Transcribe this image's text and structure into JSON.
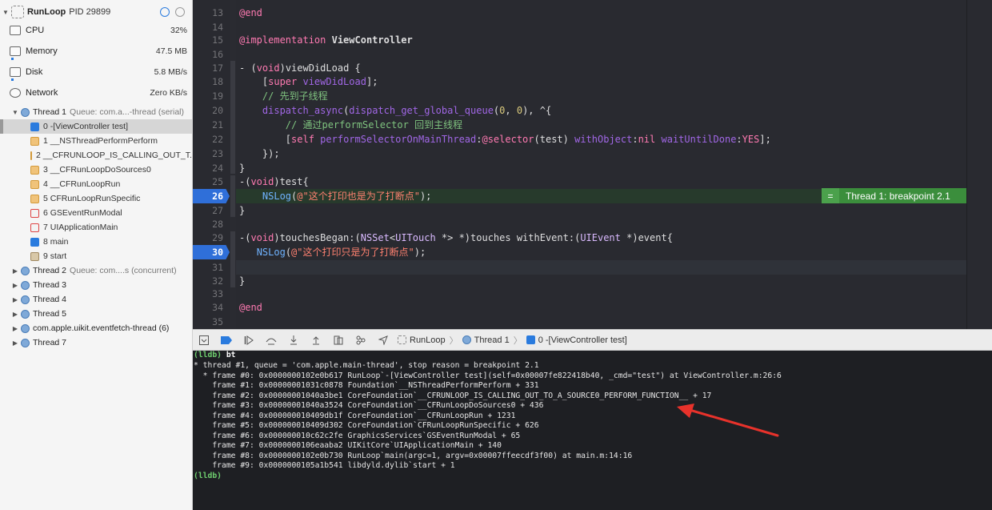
{
  "process": {
    "name": "RunLoop",
    "pid_label": "PID 29899"
  },
  "gauges": [
    {
      "label": "CPU",
      "value": "32%",
      "icon": "cpu-icon"
    },
    {
      "label": "Memory",
      "value": "47.5 MB",
      "icon": "memory-icon"
    },
    {
      "label": "Disk",
      "value": "5.8 MB/s",
      "icon": "disk-icon"
    },
    {
      "label": "Network",
      "value": "Zero KB/s",
      "icon": "network-icon"
    }
  ],
  "thread1": {
    "label": "Thread 1",
    "queue": "Queue: com.a...-thread (serial)"
  },
  "frames": [
    {
      "label": "0 -[ViewController test]",
      "kind": "user"
    },
    {
      "label": "1 __NSThreadPerformPerform",
      "kind": "sys"
    },
    {
      "label": "2 __CFRUNLOOP_IS_CALLING_OUT_T...",
      "kind": "sys"
    },
    {
      "label": "3 __CFRunLoopDoSources0",
      "kind": "sys"
    },
    {
      "label": "4 __CFRunLoopRun",
      "kind": "sys"
    },
    {
      "label": "5 CFRunLoopRunSpecific",
      "kind": "sys"
    },
    {
      "label": "6 GSEventRunModal",
      "kind": "red"
    },
    {
      "label": "7 UIApplicationMain",
      "kind": "red"
    },
    {
      "label": "8 main",
      "kind": "user"
    },
    {
      "label": "9 start",
      "kind": "grey"
    }
  ],
  "other_threads": [
    {
      "label": "Thread 2",
      "queue": "Queue: com....s (concurrent)"
    },
    {
      "label": "Thread 3",
      "queue": ""
    },
    {
      "label": "Thread 4",
      "queue": ""
    },
    {
      "label": "Thread 5",
      "queue": ""
    },
    {
      "label": "com.apple.uikit.eventfetch-thread (6)",
      "queue": ""
    },
    {
      "label": "Thread 7",
      "queue": ""
    }
  ],
  "editor": {
    "line_numbers": [
      "13",
      "14",
      "15",
      "16",
      "17",
      "18",
      "19",
      "20",
      "21",
      "22",
      "23",
      "24",
      "25",
      "26",
      "27",
      "28",
      "29",
      "30",
      "31",
      "32",
      "33",
      "34",
      "35"
    ],
    "breakpoint_lines": [
      "26",
      "30"
    ],
    "code": {
      "l13": "@end",
      "l15_kw": "@implementation",
      "l15_name": "ViewController",
      "l17_a": "- (",
      "l17_void": "void",
      "l17_b": ")viewDidLoad {",
      "l18_a": "    [",
      "l18_super": "super",
      "l18_sp": " ",
      "l18_msg": "viewDidLoad",
      "l18_b": "];",
      "l19": "    // 先到子线程",
      "l20_a": "    ",
      "l20_fn": "dispatch_async",
      "l20_b": "(",
      "l20_fn2": "dispatch_get_global_queue",
      "l20_c": "(",
      "l20_n1": "0",
      "l20_d": ", ",
      "l20_n2": "0",
      "l20_e": "), ^{",
      "l21": "        // 通过performSelector 回到主线程",
      "l22_a": "        [",
      "l22_self": "self",
      "l22_sp": " ",
      "l22_m1": "performSelectorOnMainThread",
      "l22_c1": ":",
      "l22_sel": "@selector",
      "l22_b": "(test) ",
      "l22_m2": "withObject",
      "l22_c2": ":",
      "l22_nil": "nil",
      "l22_sp2": " ",
      "l22_m3": "waitUntilDone",
      "l22_c3": ":",
      "l22_yes": "YES",
      "l22_c": "];",
      "l23": "    });",
      "l24": "}",
      "l25_a": "-(",
      "l25_void": "void",
      "l25_b": ")test{",
      "l26_a": "    ",
      "l26_fn": "NSLog",
      "l26_b": "(",
      "l26_str": "@\"这个打印也是为了打断点\"",
      "l26_c": ");",
      "l27": "}",
      "l29_a": "-(",
      "l29_void": "void",
      "l29_b": ")touchesBegan:(",
      "l29_set": "NSSet",
      "l29_c": "<",
      "l29_touch": "UITouch",
      "l29_d": " *> *)touches ",
      "l29_with": "withEvent",
      "l29_e": ":(",
      "l29_ev": "UIEvent",
      "l29_f": " *)event{",
      "l30_a": "   ",
      "l30_fn": "NSLog",
      "l30_b": "(",
      "l30_str": "@\"这个打印只是为了打断点\"",
      "l30_c": ");",
      "l32": "}",
      "l34": "@end"
    },
    "banner": {
      "icon": "=",
      "text": "Thread 1: breakpoint 2.1"
    }
  },
  "debug_bar": {
    "crumbs": [
      "RunLoop",
      "Thread 1",
      "0 -[ViewController test]"
    ]
  },
  "console": {
    "prompt": "(lldb)",
    "command": "bt",
    "lines": [
      "* thread #1, queue = 'com.apple.main-thread', stop reason = breakpoint 2.1",
      "  * frame #0: 0x0000000102e0b617 RunLoop`-[ViewController test](self=0x00007fe822418b40, _cmd=\"test\") at ViewController.m:26:6",
      "    frame #1: 0x00000001031c0878 Foundation`__NSThreadPerformPerform + 331",
      "    frame #2: 0x00000001040a3be1 CoreFoundation`__CFRUNLOOP_IS_CALLING_OUT_TO_A_SOURCE0_PERFORM_FUNCTION__ + 17",
      "    frame #3: 0x00000001040a3524 CoreFoundation`__CFRunLoopDoSources0 + 436",
      "    frame #4: 0x000000010409db1f CoreFoundation`__CFRunLoopRun + 1231",
      "    frame #5: 0x000000010409d302 CoreFoundation`CFRunLoopRunSpecific + 626",
      "    frame #6: 0x000000010c62c2fe GraphicsServices`GSEventRunModal + 65",
      "    frame #7: 0x0000000106eaaba2 UIKitCore`UIApplicationMain + 140",
      "    frame #8: 0x0000000102e0b730 RunLoop`main(argc=1, argv=0x00007ffeecdf3f00) at main.m:14:16",
      "    frame #9: 0x0000000105a1b541 libdyld.dylib`start + 1"
    ],
    "final_prompt": "(lldb)"
  },
  "colors": {
    "breakpoint": "#2f6fd9",
    "banner": "#3b8e3c",
    "annotation_arrow": "#e8322b"
  }
}
